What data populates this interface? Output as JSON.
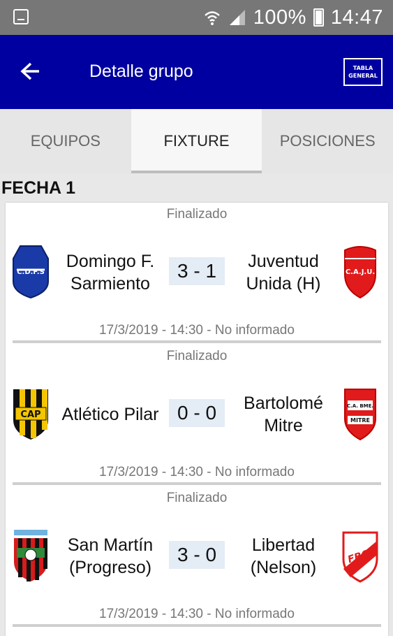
{
  "status_bar": {
    "battery": "100%",
    "time": "14:47"
  },
  "app_bar": {
    "title": "Detalle grupo",
    "tabla_line1": "TABLA",
    "tabla_line2": "GENERAL",
    "color": "#0000a0"
  },
  "tabs": [
    {
      "label": "EQUIPOS",
      "active": false
    },
    {
      "label": "FIXTURE",
      "active": true
    },
    {
      "label": "POSICIONES",
      "active": false
    }
  ],
  "section": {
    "title": "FECHA 1"
  },
  "matches": [
    {
      "status": "Finalizado",
      "home_line1": "Domingo F.",
      "home_line2": "Sarmiento",
      "home_crest_text": "C.D.F.S",
      "score": "3 - 1",
      "away_line1": "Juventud",
      "away_line2": "Unida (H)",
      "away_crest_text": "C.A.J.U.",
      "date": "17/3/2019 - 14:30 - No informado"
    },
    {
      "status": "Finalizado",
      "home_line1": "Atlético Pilar",
      "home_line2": "",
      "home_crest_text": "CAP",
      "score": "0 - 0",
      "away_line1": "Bartolomé",
      "away_line2": "Mitre",
      "away_crest_text": "C.A. BME.",
      "away_crest_text2": "MITRE",
      "date": "17/3/2019 - 14:30 - No informado"
    },
    {
      "status": "Finalizado",
      "home_line1": "San Martín",
      "home_line2": "(Progreso)",
      "score": "3 - 0",
      "away_line1": "Libertad",
      "away_line2": "(Nelson)",
      "away_crest_text": "FBCL",
      "date": "17/3/2019 - 14:30 - No informado"
    }
  ]
}
